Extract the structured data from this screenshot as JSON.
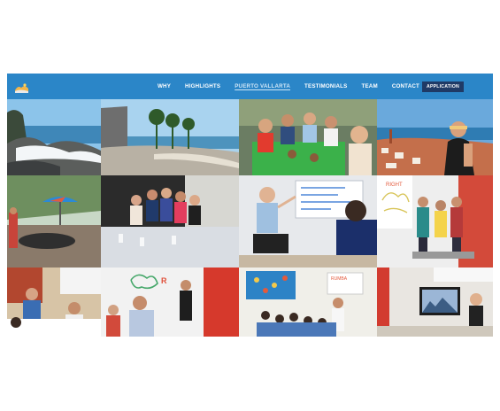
{
  "nav": {
    "items": [
      {
        "label": "WHY",
        "active": false
      },
      {
        "label": "HIGHLIGHTS",
        "active": false
      },
      {
        "label": "PUERTO VALLARTA",
        "active": true
      },
      {
        "label": "TESTIMONIALS",
        "active": false
      },
      {
        "label": "TEAM",
        "active": false
      },
      {
        "label": "CONTACT",
        "active": false
      }
    ],
    "application_label": "APPLICATION",
    "brand_color": "#2b86c8",
    "button_color": "#1f3a66"
  },
  "gallery": {
    "photos": [
      {
        "subject": "rocky-shoreline-waves"
      },
      {
        "subject": "malecon-palm-boardwalk"
      },
      {
        "subject": "group-dinner-outdoor-table"
      },
      {
        "subject": "woman-city-overlook"
      },
      {
        "subject": "pool-umbrella-terrace"
      },
      {
        "subject": "group-restaurant-table"
      },
      {
        "subject": "teacher-whiteboard-lesson"
      },
      {
        "subject": "students-classroom-standing"
      },
      {
        "subject": "classroom-group-seated"
      },
      {
        "subject": "classroom-brain-drawing"
      },
      {
        "subject": "children-classroom"
      },
      {
        "subject": "presenter-tv-screen"
      }
    ]
  }
}
